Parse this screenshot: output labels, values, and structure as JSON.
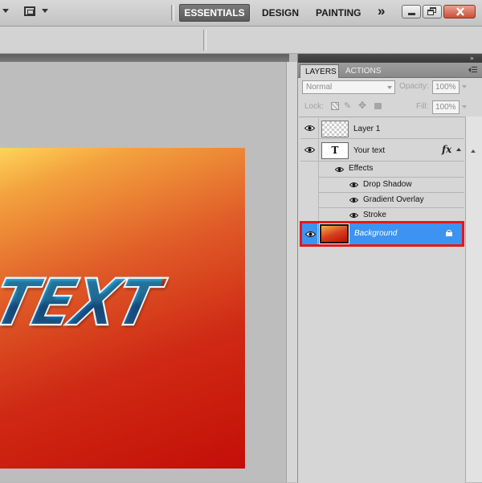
{
  "workspace": {
    "essentials": "ESSENTIALS",
    "design": "DESIGN",
    "painting": "PAINTING",
    "more": "»"
  },
  "canvas": {
    "text": "TEXT"
  },
  "panel": {
    "tabs": [
      "LAYERS",
      "ACTIONS"
    ],
    "blend_mode": "Normal",
    "opacity_label": "Opacity:",
    "opacity_value": "100%",
    "lock_label": "Lock:",
    "fill_label": "Fill:",
    "fill_value": "100%",
    "layers": [
      {
        "name": "Layer 1",
        "visible": true
      },
      {
        "name": "Your text",
        "visible": true,
        "type_glyph": "T",
        "fx_label": "fx"
      },
      {
        "name": "Background",
        "visible": true,
        "selected": true,
        "locked": true
      }
    ],
    "effects": {
      "label": "Effects",
      "items": [
        "Drop Shadow",
        "Gradient Overlay",
        "Stroke"
      ]
    }
  },
  "colors": {
    "selection": "#3d93f2",
    "highlight_border": "#e4171d",
    "active_workspace": "#5b5b5b"
  }
}
